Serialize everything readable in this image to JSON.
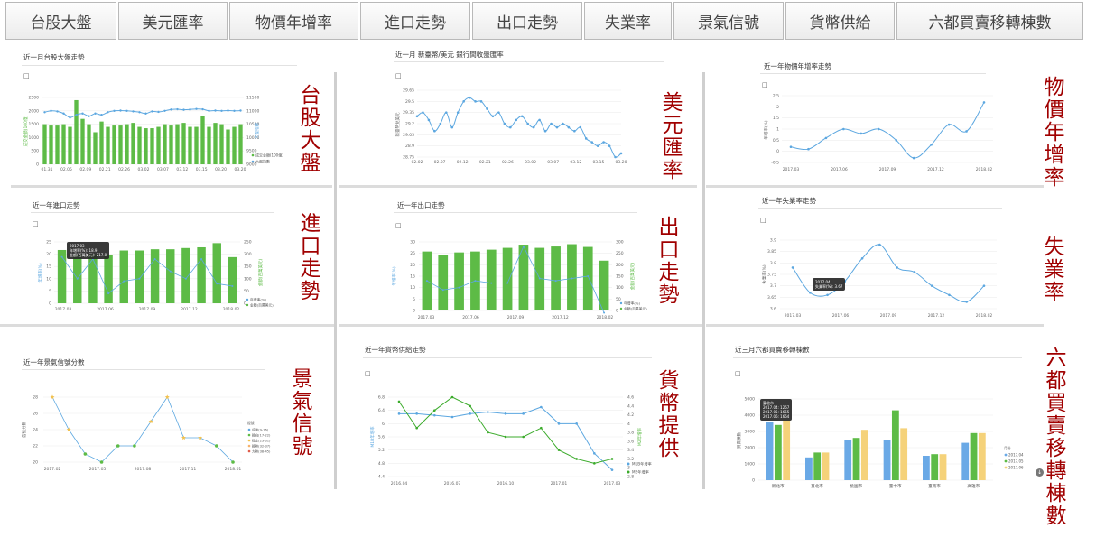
{
  "tabs": [
    "台股大盤",
    "美元匯率",
    "物價年增率",
    "進口走勢",
    "出口走勢",
    "失業率",
    "景氣信號",
    "貨幣供給",
    "六都買賣移轉棟數"
  ],
  "side_labels": [
    "台股大盤",
    "美元匯率",
    "物價年增率",
    "進口走勢",
    "出口走勢",
    "失業率",
    "景氣信號",
    "貨幣提供",
    "六都買賣移轉棟數"
  ],
  "colors": {
    "green": "#5dbb46",
    "blue": "#5ca7e0",
    "yellow": "#f5d27a",
    "red_text": "#a00000",
    "orange": "#f6b26b"
  },
  "icons": {
    "camera": "camera-icon",
    "download": "download-icon"
  },
  "panels": {
    "taiex": {
      "title": "近一月台股大盤走勢",
      "chart_data": {
        "type": "bar+line",
        "categories": [
          "01.31",
          "02.05",
          "02.09",
          "02.21",
          "02.26",
          "03.02",
          "03.07",
          "03.12",
          "03.15",
          "03.20",
          "03.20"
        ],
        "bars": [
          1500,
          1450,
          1450,
          1500,
          1400,
          2400,
          1700,
          1500,
          1200,
          1600,
          1400,
          1450,
          1450,
          1500,
          1550,
          1400,
          1350,
          1350,
          1400,
          1500,
          1450,
          1500,
          1550,
          1400,
          1400,
          1800,
          1400,
          1550,
          1500,
          1300,
          1400,
          1500
        ],
        "line": [
          10950,
          11000,
          10980,
          10900,
          10750,
          10850,
          10900,
          10800,
          10900,
          10850,
          10950,
          11000,
          11010,
          11000,
          10980,
          10950,
          10900,
          10980,
          10960,
          11000,
          11050,
          11060,
          11040,
          11050,
          11070,
          11060,
          11000,
          11010,
          11000,
          11010,
          11000,
          11010
        ],
        "y_left": [
          0,
          500,
          1000,
          1500,
          2000,
          2500
        ],
        "y_right": [
          "9000",
          "9500",
          "10000",
          "10500",
          "11000",
          "11500"
        ],
        "ylabel_left": "成交金額(100億)",
        "ylabel_right": "大盤指數",
        "legend": [
          "成交金額(100億)",
          "大盤指數"
        ]
      }
    },
    "usd": {
      "title": "近一月 新臺幣/美元 銀行間收盤匯率",
      "chart_data": {
        "type": "line",
        "categories": [
          "02.02",
          "02.07",
          "02.12",
          "02.21",
          "02.26",
          "03.02",
          "03.07",
          "03.12",
          "03.15",
          "03.20"
        ],
        "values": [
          29.3,
          29.35,
          29.25,
          29.1,
          29.2,
          29.35,
          29.15,
          29.35,
          29.5,
          29.55,
          29.5,
          29.5,
          29.4,
          29.3,
          29.35,
          29.2,
          29.15,
          29.25,
          29.3,
          29.2,
          29.15,
          29.25,
          29.1,
          29.2,
          29.15,
          29.2,
          29.15,
          29.1,
          29.15,
          29.0,
          28.95,
          28.9,
          28.95,
          28.9,
          28.75,
          28.8
        ],
        "y_ticks": [
          "28.75",
          "28.9",
          "29.05",
          "29.2",
          "29.35",
          "29.5",
          "29.65"
        ],
        "ylabel": "新臺幣兌美元"
      }
    },
    "cpi": {
      "title": "近一年物價年增率走勢",
      "chart_data": {
        "type": "line",
        "categories": [
          "2017.03",
          "2017.06",
          "2017.09",
          "2017.12",
          "2018.02"
        ],
        "values": [
          0.2,
          0.1,
          0.6,
          1.0,
          0.8,
          1.0,
          0.5,
          -0.3,
          0.3,
          1.2,
          0.9,
          2.2
        ],
        "y_ticks": [
          "-0.5",
          "0",
          "0.5",
          "1",
          "1.5",
          "2",
          "2.5"
        ],
        "ylabel": "年增率(%)"
      }
    },
    "import": {
      "title": "近一年進口走勢",
      "tooltip": [
        "2017.03",
        "年增率(%): 18.9",
        "金額(百萬美元): 217.0"
      ],
      "chart_data": {
        "type": "bar+line",
        "categories": [
          "2017.03",
          "2017.06",
          "2017.09",
          "2017.12",
          "2018.02"
        ],
        "bars": [
          217,
          200,
          200,
          195,
          215,
          215,
          220,
          220,
          225,
          228,
          245,
          188
        ],
        "line": [
          18.9,
          10,
          18,
          4,
          9,
          10,
          18,
          13,
          10,
          18,
          8,
          7
        ],
        "y_left": [
          0,
          5,
          10,
          15,
          20,
          25
        ],
        "y_right": [
          "0",
          "50",
          "100",
          "150",
          "200",
          "250"
        ],
        "ylabel_left": "年增率(%)",
        "ylabel_right": "金額(百萬美元)",
        "legend": [
          "年增率(%)",
          "金額(百萬美元)"
        ]
      }
    },
    "export": {
      "title": "近一年出口走勢",
      "chart_data": {
        "type": "bar+line",
        "categories": [
          "2017.03",
          "2017.06",
          "2017.09",
          "2017.12",
          "2018.02"
        ],
        "bars": [
          258,
          244,
          254,
          258,
          266,
          274,
          288,
          274,
          280,
          290,
          278,
          218
        ],
        "line": [
          13,
          9,
          10,
          13,
          12,
          12,
          28,
          14,
          13,
          14,
          15,
          -1
        ],
        "y_left": [
          0,
          5,
          10,
          15,
          20,
          25,
          30
        ],
        "y_right": [
          "0",
          "50",
          "100",
          "150",
          "200",
          "250",
          "300"
        ],
        "ylabel_left": "年增率(%)",
        "ylabel_right": "金額(百萬美元)",
        "legend": [
          "年增率(%)",
          "金額(百萬美元)"
        ]
      }
    },
    "unemp": {
      "title": "近一年失業率走勢",
      "tooltip": [
        "2017.04",
        "失業率(%): 3.67"
      ],
      "chart_data": {
        "type": "line",
        "categories": [
          "2017.03",
          "2017.06",
          "2017.09",
          "2017.12",
          "2018.02"
        ],
        "values": [
          3.78,
          3.67,
          3.66,
          3.72,
          3.82,
          3.88,
          3.78,
          3.76,
          3.7,
          3.66,
          3.63,
          3.7
        ],
        "y_ticks": [
          "3.6",
          "3.65",
          "3.7",
          "3.75",
          "3.8",
          "3.85",
          "3.9"
        ],
        "ylabel": "失業率(%)"
      }
    },
    "signal": {
      "title": "近一年景氣信號分數",
      "chart_data": {
        "type": "line",
        "categories": [
          "2017.02",
          "2017.05",
          "2017.08",
          "2017.11",
          "2018.01"
        ],
        "values": [
          28,
          24,
          21,
          20,
          22,
          22,
          25,
          28,
          23,
          23,
          22,
          20
        ],
        "y_ticks": [
          "20",
          "22",
          "24",
          "26",
          "28"
        ],
        "ylabel": "信號分數",
        "legend_title": "燈號",
        "legend": [
          "低迷(9-16)",
          "轉向(17-22)",
          "穩定(23-31)",
          "轉熱(32-37)",
          "大熱(38-45)"
        ]
      }
    },
    "money": {
      "title": "近一年貨幣供給走勢",
      "chart_data": {
        "type": "line",
        "categories": [
          "2016.04",
          "2016.07",
          "2016.10",
          "2017.01",
          "2017.03"
        ],
        "series": [
          {
            "name": "M1B年增率",
            "values": [
              6.3,
              6.3,
              6.25,
              6.2,
              6.3,
              6.35,
              6.3,
              6.3,
              6.5,
              6.0,
              6.0,
              5.1,
              4.6
            ]
          },
          {
            "name": "M2年增率",
            "values": [
              4.5,
              3.9,
              4.3,
              4.6,
              4.4,
              3.8,
              3.7,
              3.7,
              3.9,
              3.4,
              3.2,
              3.1,
              3.2
            ]
          }
        ],
        "y_left": [
          "4.4",
          "4.8",
          "5.2",
          "5.6",
          "6",
          "6.4",
          "6.8"
        ],
        "y_right": [
          "2.8",
          "3",
          "3.2",
          "3.4",
          "3.6",
          "3.8",
          "4",
          "4.2",
          "4.4",
          "4.6"
        ],
        "ylabel_left": "M1B年增率",
        "ylabel_right": "M2年增率"
      }
    },
    "housing": {
      "title": "近三月六都買賣移轉棟數",
      "tooltip": [
        "臺北市",
        "2017.04: 1267",
        "2017.05: 1655",
        "2017.06: 1664"
      ],
      "chart_data": {
        "type": "bar",
        "categories": [
          "新北市",
          "臺北市",
          "桃園市",
          "臺中市",
          "臺南市",
          "高雄市"
        ],
        "series": [
          {
            "name": "2017.04",
            "values": [
              3600,
              1400,
              2500,
              2500,
              1500,
              2300
            ]
          },
          {
            "name": "2017.05",
            "values": [
              3400,
              1700,
              2600,
              4300,
              1600,
              2900
            ]
          },
          {
            "name": "2017.06",
            "values": [
              3700,
              1700,
              3100,
              3200,
              1600,
              2900
            ]
          }
        ],
        "y_ticks": [
          "0",
          "1000",
          "2000",
          "3000",
          "4000",
          "5000"
        ],
        "ylabel": "買賣棟數",
        "legend_title": "月份"
      }
    }
  }
}
